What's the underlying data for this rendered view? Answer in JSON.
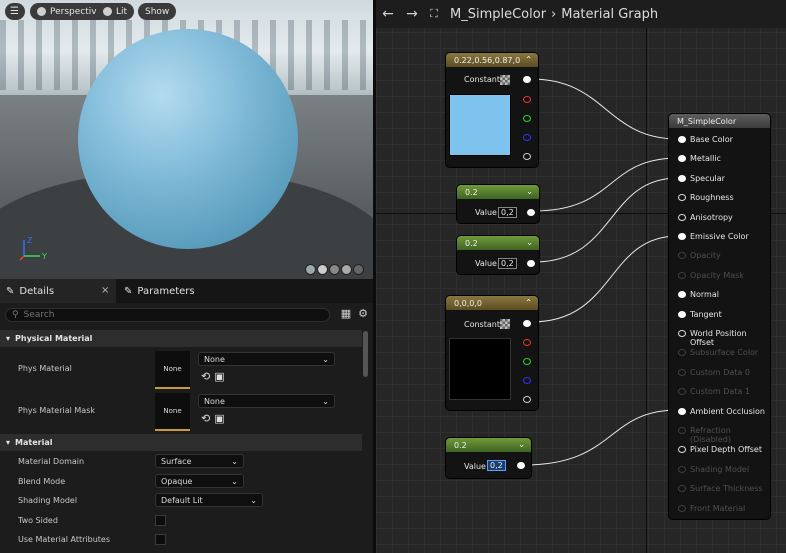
{
  "viewport": {
    "menu_icon": "hamburger-icon",
    "perspective_label": "Perspective",
    "lit_label": "Lit",
    "show_label": "Show",
    "axis_z": "Z",
    "axis_y": "Y",
    "sphere_color": "#7fbad8"
  },
  "details": {
    "tab_details": "Details",
    "tab_parameters": "Parameters",
    "close": "×",
    "search_placeholder": "Search",
    "sections": {
      "physical": "Physical Material",
      "material": "Material"
    },
    "rows": {
      "phys_material": "Phys Material",
      "phys_material_mask": "Phys Material Mask",
      "thumb_none": "None",
      "dropdown_none": "None",
      "material_domain": "Material Domain",
      "material_domain_value": "Surface",
      "blend_mode": "Blend Mode",
      "blend_mode_value": "Opaque",
      "shading_model": "Shading Model",
      "shading_model_value": "Default Lit",
      "two_sided": "Two Sided",
      "use_material_attributes": "Use Material Attributes"
    }
  },
  "graph": {
    "breadcrumb_asset": "M_SimpleColor",
    "breadcrumb_sep": "›",
    "breadcrumb_page": "Material Graph",
    "node_const1": {
      "title": "0.22,0.56,0.87,0",
      "label": "Constant",
      "swatch": "#7ec3ee"
    },
    "node_scalar1": {
      "title": "0.2",
      "label": "Value",
      "value": "0,2"
    },
    "node_scalar2": {
      "title": "0.2",
      "label": "Value",
      "value": "0,2"
    },
    "node_const2": {
      "title": "0,0,0,0",
      "label": "Constant",
      "swatch": "#000000"
    },
    "node_scalar3": {
      "title": "0.2",
      "label": "Value",
      "value": "0,2"
    },
    "result": {
      "title": "M_SimpleColor",
      "inputs": [
        {
          "label": "Base Color",
          "enabled": true
        },
        {
          "label": "Metallic",
          "enabled": true
        },
        {
          "label": "Specular",
          "enabled": true
        },
        {
          "label": "Roughness",
          "enabled": true
        },
        {
          "label": "Anisotropy",
          "enabled": true
        },
        {
          "label": "Emissive Color",
          "enabled": true
        },
        {
          "label": "Opacity",
          "enabled": false
        },
        {
          "label": "Opacity Mask",
          "enabled": false
        },
        {
          "label": "Normal",
          "enabled": true
        },
        {
          "label": "Tangent",
          "enabled": true
        },
        {
          "label": "World Position Offset",
          "enabled": true
        },
        {
          "label": "Subsurface Color",
          "enabled": false
        },
        {
          "label": "Custom Data 0",
          "enabled": false
        },
        {
          "label": "Custom Data 1",
          "enabled": false
        },
        {
          "label": "Ambient Occlusion",
          "enabled": true
        },
        {
          "label": "Refraction (Disabled)",
          "enabled": false
        },
        {
          "label": "Pixel Depth Offset",
          "enabled": true
        },
        {
          "label": "Shading Model",
          "enabled": false
        },
        {
          "label": "Surface Thickness",
          "enabled": false
        },
        {
          "label": "Front Material",
          "enabled": false
        }
      ]
    }
  }
}
